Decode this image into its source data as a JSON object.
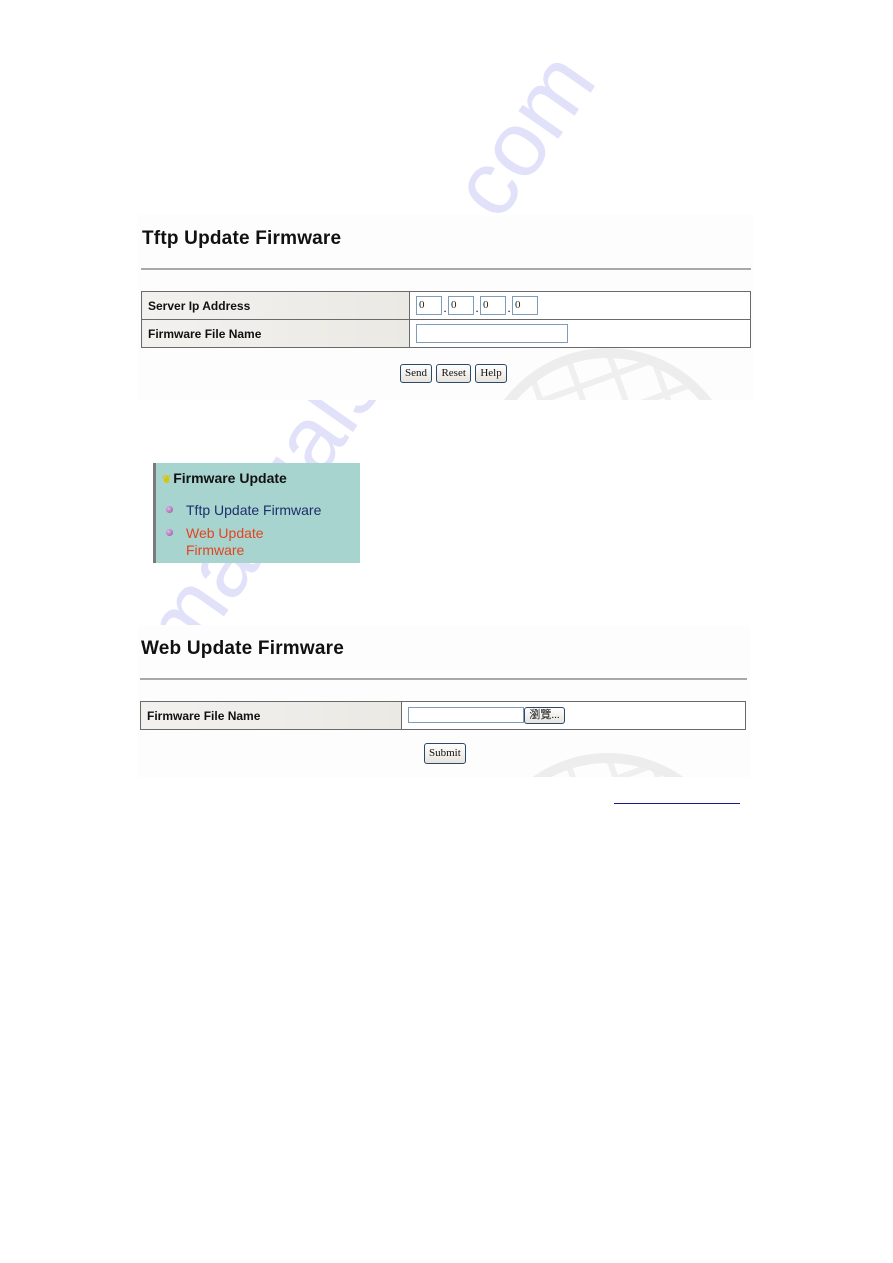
{
  "tftp": {
    "title": "Tftp Update Firmware",
    "rows": [
      {
        "label": "Server Ip Address",
        "ip": [
          "0",
          "0",
          "0",
          "0"
        ]
      },
      {
        "label": "Firmware File Name",
        "value": ""
      }
    ],
    "buttons": {
      "send": "Send",
      "reset": "Reset",
      "help": "Help"
    }
  },
  "menu": {
    "header": "Firmware Update",
    "items": [
      {
        "label": "Tftp Update Firmware",
        "color": "#1c2f6b"
      },
      {
        "label_line1": "Web Update",
        "label_line2": "Firmware",
        "color": "#e0451f"
      }
    ]
  },
  "web": {
    "title": "Web Update Firmware",
    "row": {
      "label": "Firmware File Name",
      "value": ""
    },
    "browse_label": "瀏覽...",
    "submit_label": "Submit"
  },
  "watermark": "manualshive.com"
}
